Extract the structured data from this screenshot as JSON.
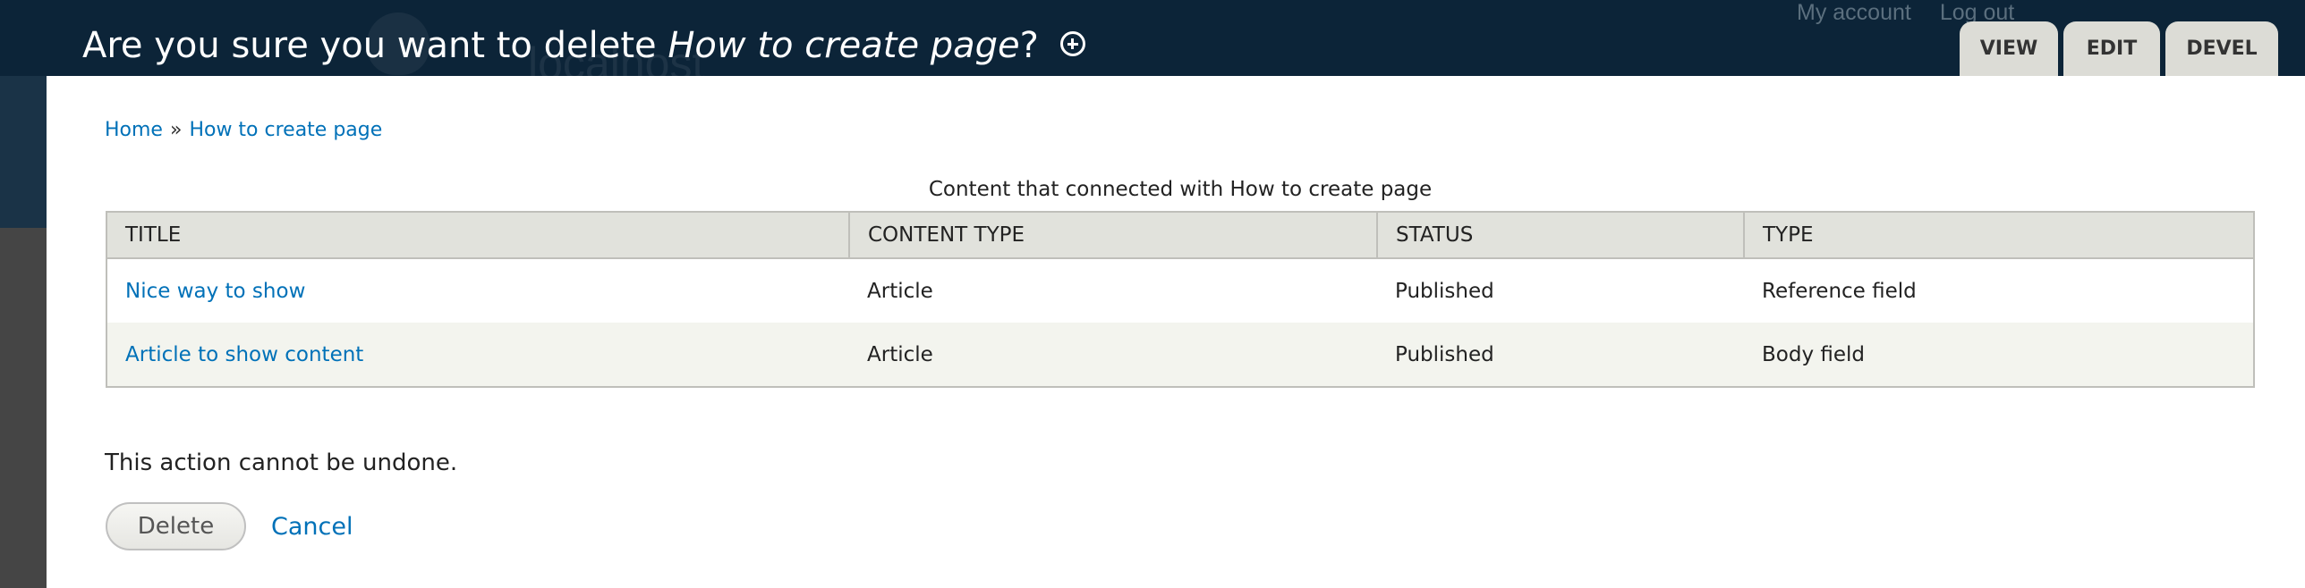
{
  "header": {
    "title_prefix": "Are you sure you want to delete ",
    "title_item": "How to create page",
    "title_suffix": "?",
    "secondary_links": [
      "My account",
      "Log out"
    ],
    "tabs": [
      "VIEW",
      "EDIT",
      "DEVEL"
    ],
    "contextual_icon": "plus-circle-icon"
  },
  "breadcrumb": {
    "home": "Home",
    "separator": "»",
    "current": "How to create page"
  },
  "table": {
    "caption": "Content that connected with How to create page",
    "columns": [
      "TITLE",
      "CONTENT TYPE",
      "STATUS",
      "TYPE"
    ],
    "rows": [
      {
        "title": "Nice way to show",
        "content_type": "Article",
        "status": "Published",
        "type": "Reference field"
      },
      {
        "title": "Article to show content",
        "content_type": "Article",
        "status": "Published",
        "type": "Body field"
      }
    ]
  },
  "form": {
    "warning": "This action cannot be undone.",
    "delete_label": "Delete",
    "cancel_label": "Cancel"
  },
  "colors": {
    "header_bg": "#0c2438",
    "link": "#0071b8",
    "tab_bg": "#dcdcd6",
    "table_header_bg": "#e1e2dc",
    "row_even_bg": "#f3f4ee"
  }
}
